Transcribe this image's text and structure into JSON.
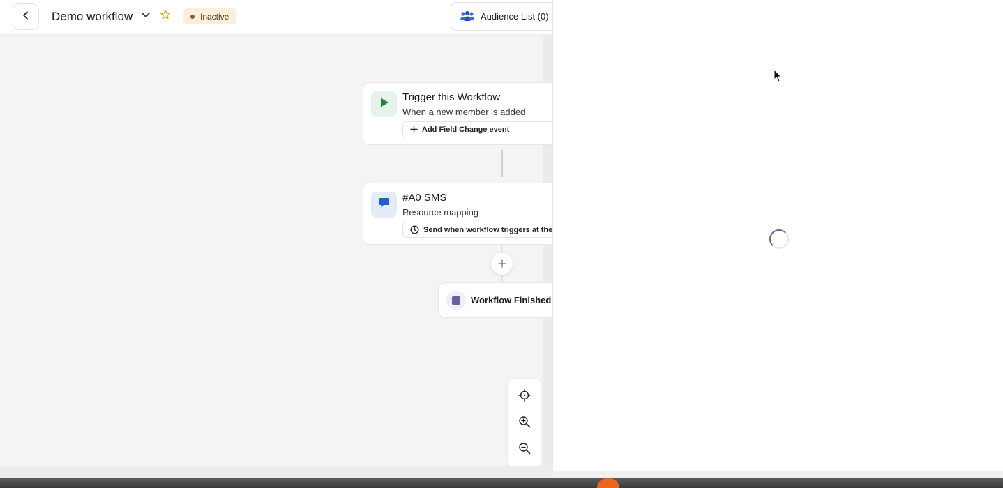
{
  "header": {
    "title": "Demo workflow",
    "status": "Inactive",
    "audience_button": "Audience List (0)"
  },
  "nodes": {
    "trigger": {
      "title": "Trigger this Workflow",
      "subtitle": "When a new member is added",
      "action": "Add Field Change event"
    },
    "sms": {
      "title": "#A0 SMS",
      "subtitle": "Resource mapping",
      "schedule": "Send when workflow triggers at the s"
    },
    "finish": {
      "label": "Workflow Finished"
    }
  },
  "icons": {
    "back": "chevron-left-icon",
    "title_menu": "chevron-down-icon",
    "favorite": "star-icon",
    "audience": "people-icon",
    "trigger": "play-icon",
    "sms": "chat-bubble-icon",
    "add_event": "plus-icon",
    "schedule": "clock-icon",
    "recenter": "crosshair-icon",
    "zoom_in": "zoom-in-icon",
    "zoom_out": "zoom-out-icon"
  },
  "colors": {
    "trigger_green": "#1f8a3b",
    "sms_blue": "#1f5fd1",
    "finish_purple": "#6b5e9c",
    "star_gold": "#d9a400",
    "badge_bg": "#fbefdc"
  }
}
